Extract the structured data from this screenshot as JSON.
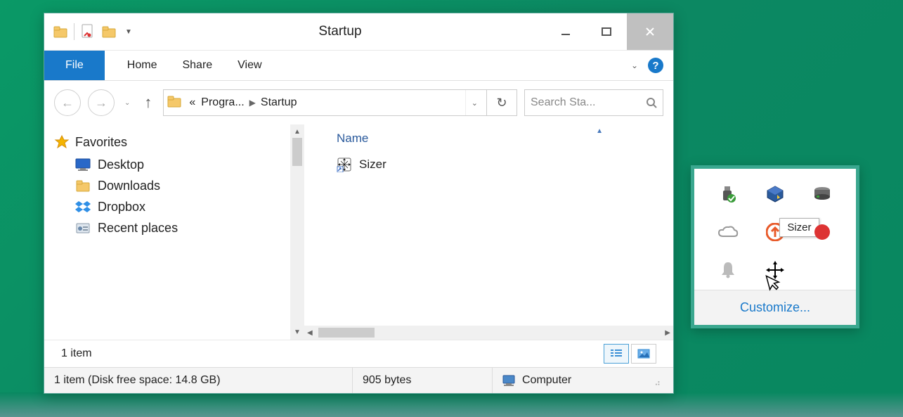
{
  "window": {
    "title": "Startup"
  },
  "ribbon": {
    "file_label": "File",
    "tabs": [
      "Home",
      "Share",
      "View"
    ]
  },
  "breadcrumb": {
    "chevron": "«",
    "part1": "Progra...",
    "part2": "Startup"
  },
  "search": {
    "placeholder": "Search Sta..."
  },
  "sidebar": {
    "favorites_label": "Favorites",
    "items": [
      {
        "label": "Desktop"
      },
      {
        "label": "Downloads"
      },
      {
        "label": "Dropbox"
      },
      {
        "label": "Recent places"
      }
    ]
  },
  "filepane": {
    "column_name": "Name",
    "items": [
      {
        "label": "Sizer"
      }
    ]
  },
  "footer": {
    "item_count": "1 item",
    "status_left": "1 item (Disk free space: 14.8 GB)",
    "status_bytes": "905 bytes",
    "status_location": "Computer"
  },
  "tray": {
    "tooltip": "Sizer",
    "customize": "Customize..."
  }
}
